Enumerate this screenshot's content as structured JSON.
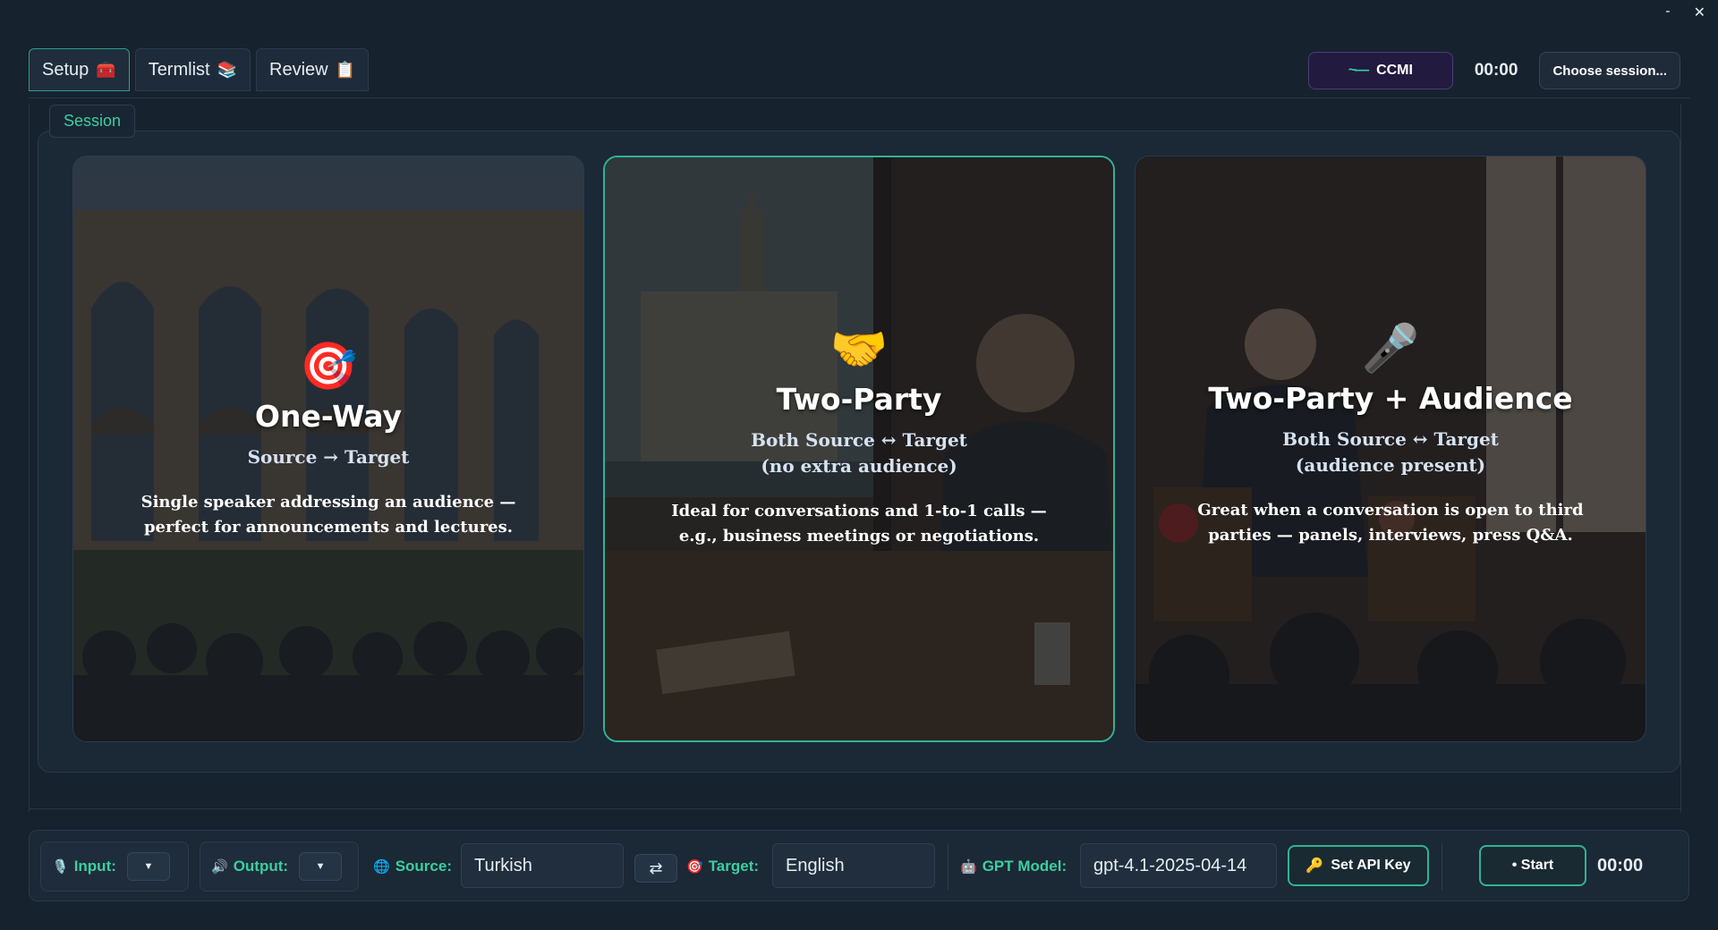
{
  "window": {
    "minimize_label": "-",
    "close_label": "✕"
  },
  "tabs": [
    {
      "label": "Setup",
      "icon": "🧰",
      "active": true
    },
    {
      "label": "Termlist",
      "icon": "📚",
      "active": false
    },
    {
      "label": "Review",
      "icon": "📋",
      "active": false
    }
  ],
  "header": {
    "brand_icon": "~—",
    "brand_label": "CCMI",
    "timer": "00:00",
    "choose_session_label": "Choose session..."
  },
  "session": {
    "group_label": "Session",
    "cards": [
      {
        "icon": "🎯",
        "title": "One-Way",
        "subtitle": "Source → Target",
        "subtitle2": "",
        "description_line1": "Single speaker addressing an audience —",
        "description_line2": "perfect for announcements and lectures.",
        "selected": false
      },
      {
        "icon": "🤝",
        "title": "Two-Party",
        "subtitle": "Both Source ↔ Target",
        "subtitle2": "(no extra audience)",
        "description_line1": "Ideal for conversations and 1-to-1 calls —",
        "description_line2": "e.g., business meetings or negotiations.",
        "selected": true
      },
      {
        "icon": "🎤",
        "title": "Two-Party + Audience",
        "subtitle": "Both Source ↔ Target",
        "subtitle2": "(audience present)",
        "description_line1": "Great when a conversation is open to third",
        "description_line2": "parties — panels, interviews, press Q&A.",
        "selected": false
      }
    ]
  },
  "bottom_bar": {
    "input_icon": "🎙️",
    "input_label": "Input:",
    "output_icon": "🔊",
    "output_label": "Output:",
    "dropdown_arrow": "▼",
    "source_icon": "🌐",
    "source_label": "Source:",
    "source_value": "Turkish",
    "swap_label": "⇄",
    "target_icon": "🎯",
    "target_label": "Target:",
    "target_value": "English",
    "model_icon": "🤖",
    "model_label": "GPT Model:",
    "model_value": "gpt-4.1-2025-04-14",
    "api_key_icon": "🔑",
    "api_key_label": "Set API Key",
    "start_label": "• Start",
    "timer": "00:00"
  },
  "colors": {
    "accent": "#3ccfa0",
    "background": "#17222f",
    "panel": "#1b2836",
    "selected_border": "#2fb394"
  }
}
